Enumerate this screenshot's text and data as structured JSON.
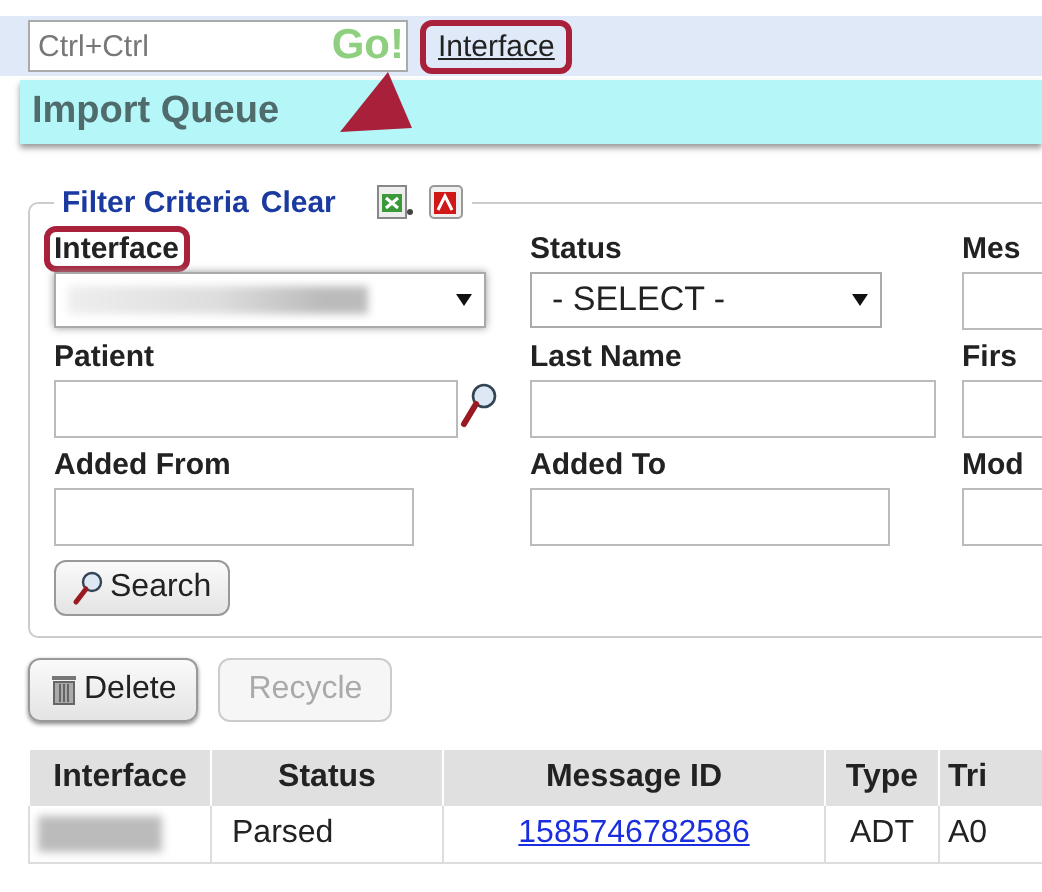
{
  "toolbar": {
    "search": {
      "placeholder": "Ctrl+Ctrl"
    },
    "go_button": "Go!",
    "link": {
      "label": "Interface",
      "highlighted": true
    }
  },
  "page_title": "Import Queue",
  "filter": {
    "legend": "Filter Criteria",
    "clear_link": "Clear",
    "fields": [
      {
        "label": "Interface",
        "kind": "select",
        "redacted": true,
        "highlighted": true
      },
      {
        "label": "Status",
        "kind": "select",
        "value": "- SELECT -",
        "redacted": false,
        "highlighted": false
      },
      {
        "label": "Mes",
        "kind": "input",
        "highlighted": false
      },
      {
        "label": "Patient",
        "kind": "lookup",
        "highlighted": false
      },
      {
        "label": "Last Name",
        "kind": "input",
        "highlighted": false
      },
      {
        "label": "Firs",
        "kind": "input",
        "highlighted": false
      },
      {
        "label": "Added From",
        "kind": "input",
        "highlighted": false
      },
      {
        "label": "Added To",
        "kind": "input",
        "highlighted": false
      },
      {
        "label": "Mod",
        "kind": "input",
        "highlighted": false
      }
    ],
    "search_button": "Search"
  },
  "actions": [
    {
      "label": "Delete",
      "kind": "trash",
      "disabled": false
    },
    {
      "label": "Recycle",
      "kind": "plain",
      "disabled": true
    }
  ],
  "table": {
    "columns": [
      "Interface",
      "Status",
      "Message ID",
      "Type",
      "Tri"
    ],
    "rows": [
      {
        "cells": [
          {
            "kind": "redacted"
          },
          {
            "kind": "text",
            "text": "Parsed"
          },
          {
            "kind": "link",
            "text": "1585746782586"
          },
          {
            "kind": "text",
            "text": "ADT"
          },
          {
            "kind": "text",
            "text": "A0"
          }
        ]
      }
    ]
  }
}
